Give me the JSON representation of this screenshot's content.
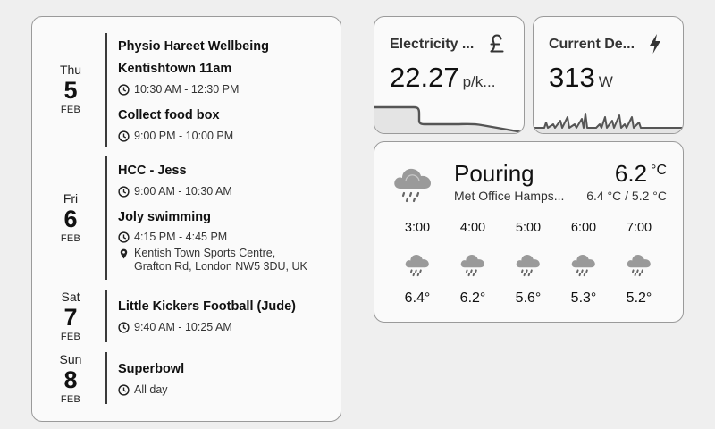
{
  "calendar": {
    "days": [
      {
        "dow": "Thu",
        "day": "5",
        "month": "FEB",
        "events": [
          {
            "title": "Physio Hareet Wellbeing",
            "title2": "Kentishtown 11am",
            "time": "10:30 AM - 12:30 PM"
          },
          {
            "title": "Collect food box",
            "time": "9:00 PM - 10:00 PM"
          }
        ]
      },
      {
        "dow": "Fri",
        "day": "6",
        "month": "FEB",
        "events": [
          {
            "title": "HCC - Jess",
            "time": "9:00 AM - 10:30 AM"
          },
          {
            "title": "Joly swimming",
            "time": "4:15 PM - 4:45 PM",
            "location_line1": "Kentish Town Sports Centre,",
            "location_line2": "Grafton Rd, London NW5 3DU, UK"
          }
        ]
      },
      {
        "dow": "Sat",
        "day": "7",
        "month": "FEB",
        "events": [
          {
            "title": "Little Kickers Football (Jude)",
            "time": "9:40 AM - 10:25 AM"
          }
        ]
      },
      {
        "dow": "Sun",
        "day": "8",
        "month": "FEB",
        "events": [
          {
            "title": "Superbowl",
            "time": "All day"
          }
        ]
      }
    ]
  },
  "electricity": {
    "name": "Electricity ...",
    "value": "22.27",
    "unit": "p/k...",
    "icon": "pound-sign-icon"
  },
  "power": {
    "name": "Current De...",
    "value": "313",
    "unit": "W",
    "icon": "lightning-bolt-icon"
  },
  "weather": {
    "condition": "Pouring",
    "temperature": "6.2",
    "temp_unit": "°C",
    "location": "Met Office Hamps...",
    "range": "6.4 °C / 5.2 °C",
    "icon": "pouring-rain-icon",
    "forecast": [
      {
        "time": "3:00",
        "temp": "6.4°"
      },
      {
        "time": "4:00",
        "temp": "6.2°"
      },
      {
        "time": "5:00",
        "temp": "5.6°"
      },
      {
        "time": "6:00",
        "temp": "5.3°"
      },
      {
        "time": "7:00",
        "temp": "5.2°"
      }
    ]
  },
  "colors": {
    "background": "#efefef",
    "card": "#fafafa",
    "border": "#9a9a9a",
    "graph_fill": "#e4e4e4",
    "graph_line": "#555555"
  }
}
